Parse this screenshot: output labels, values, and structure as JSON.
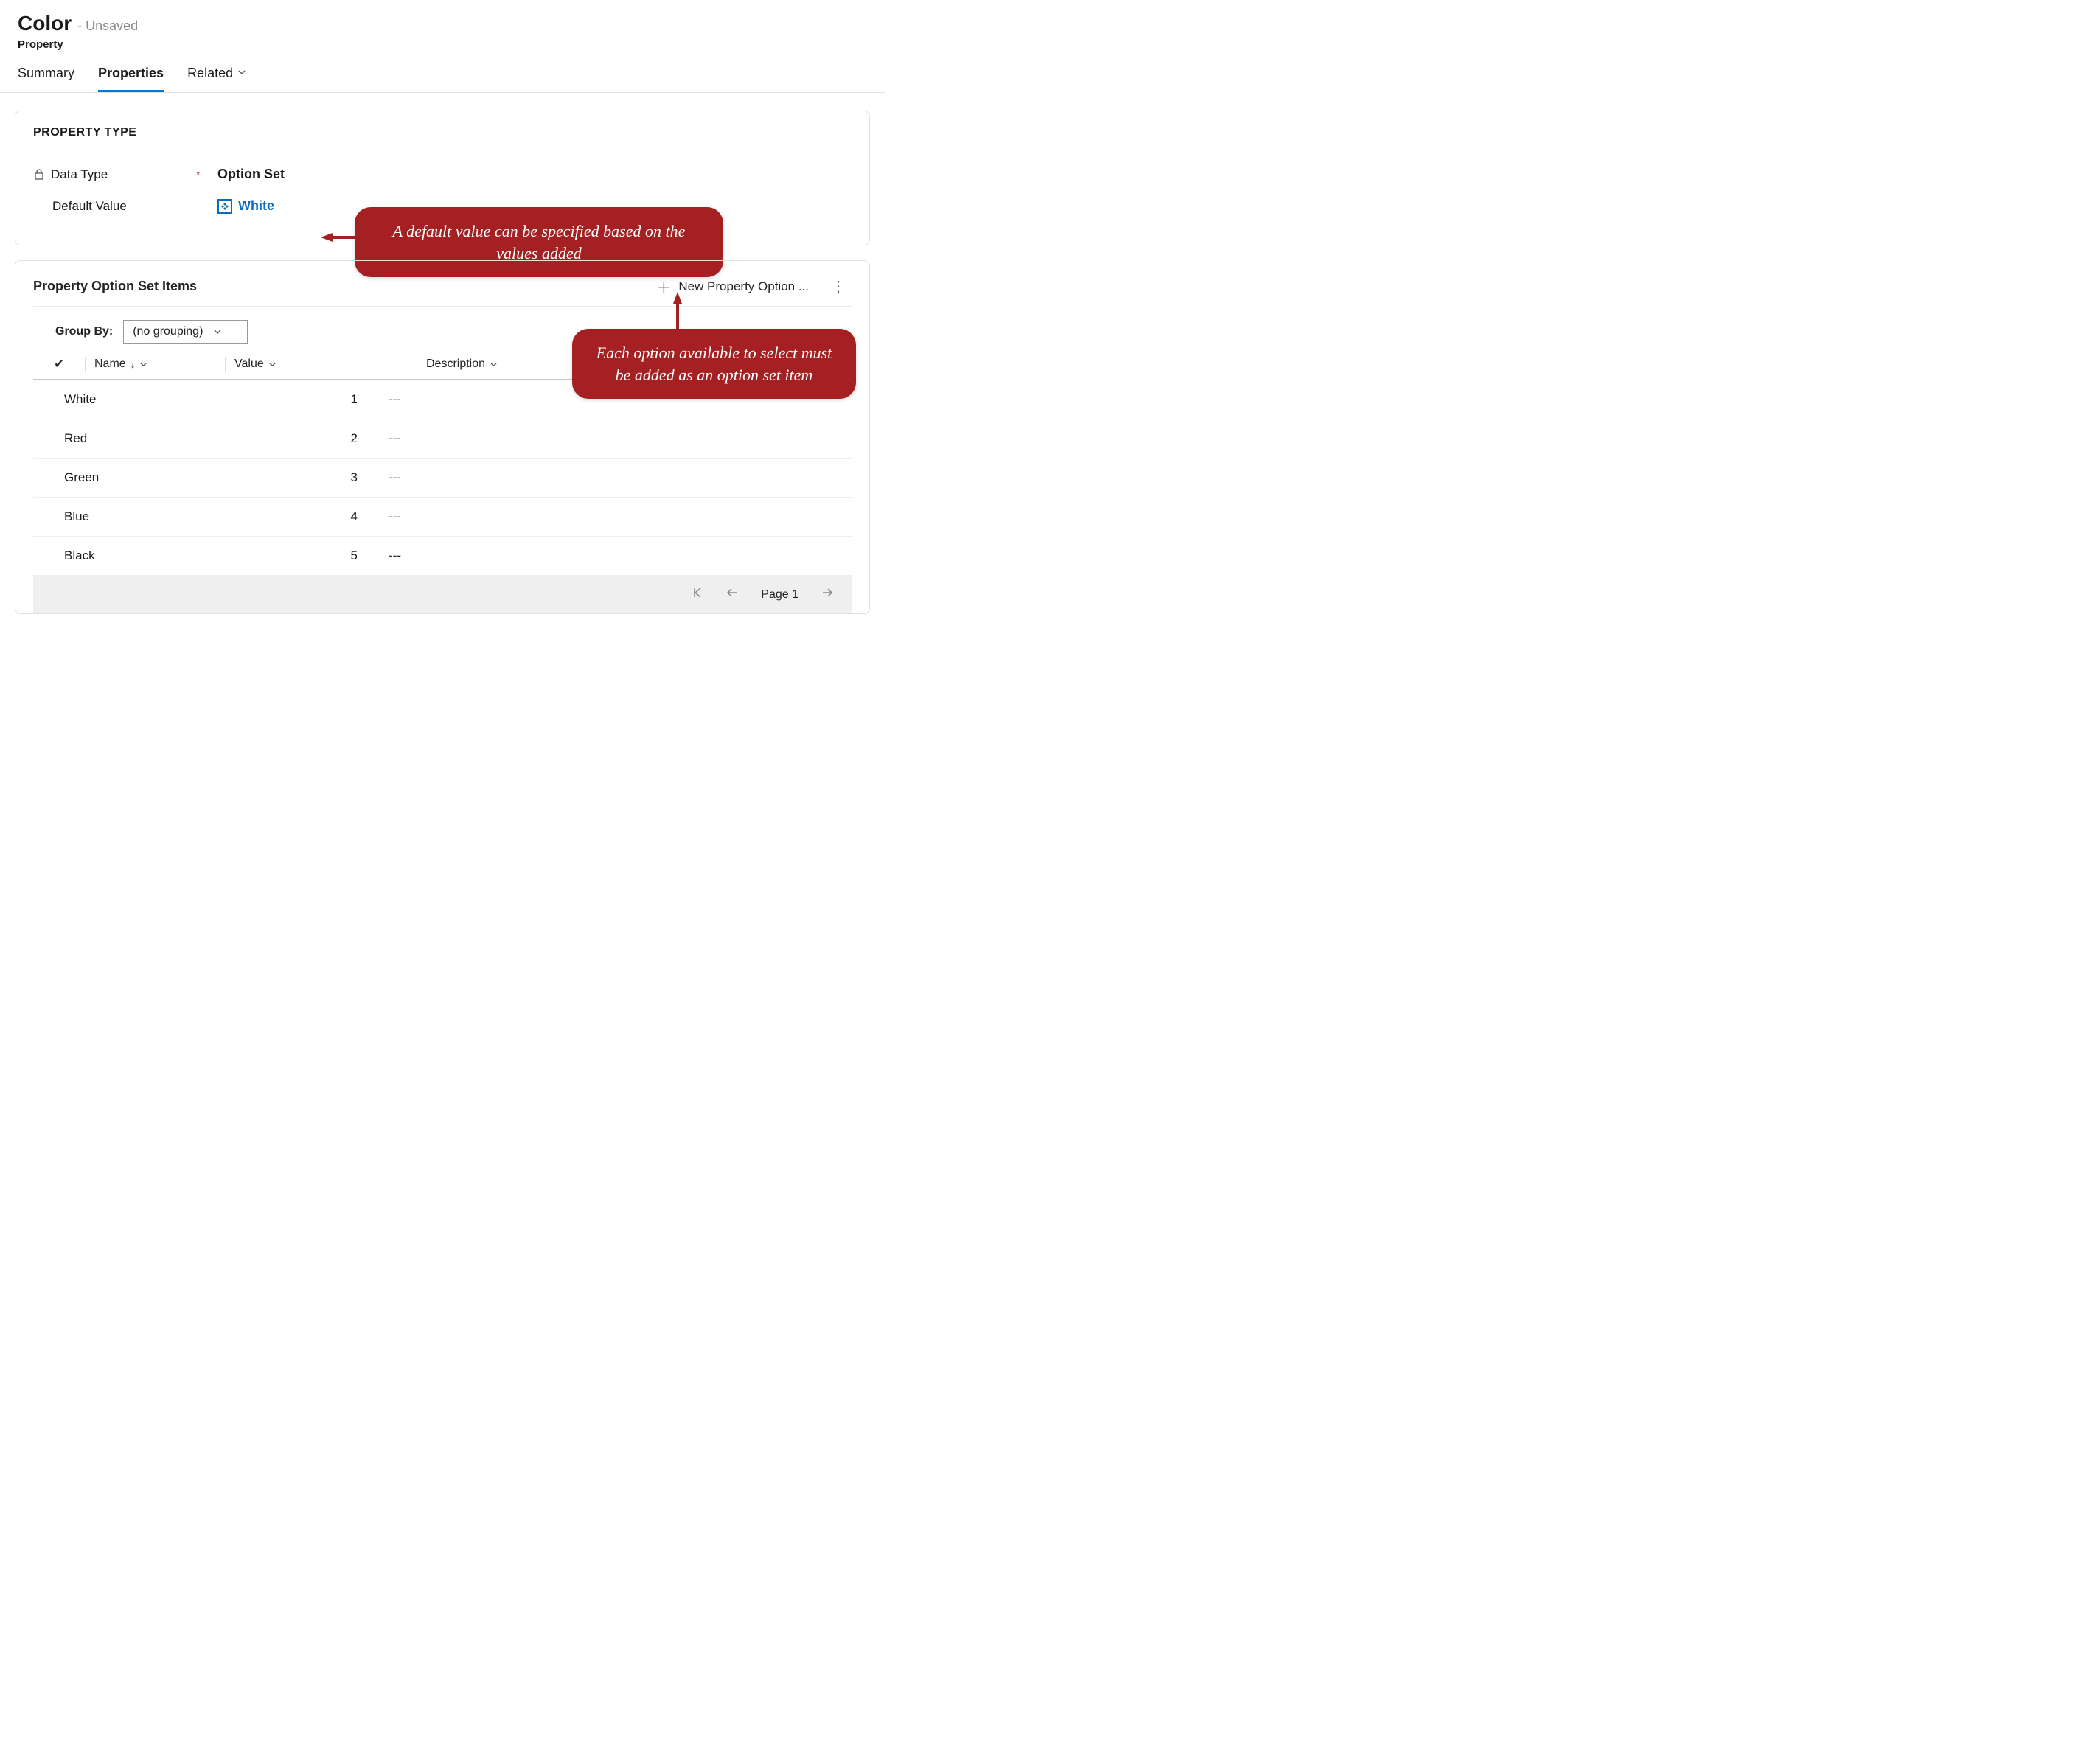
{
  "header": {
    "title": "Color",
    "status": "- Unsaved",
    "entity": "Property"
  },
  "tabs": {
    "summary": "Summary",
    "properties": "Properties",
    "related": "Related"
  },
  "property_type_section": {
    "heading": "PROPERTY TYPE",
    "data_type_label": "Data Type",
    "data_type_value": "Option Set",
    "default_value_label": "Default Value",
    "default_value": "White"
  },
  "callouts": {
    "default_value": "A default value can be specified based on the values added",
    "new_option": "Each option available to select must be added as an option set item"
  },
  "option_set_section": {
    "title": "Property Option Set Items",
    "new_button": "New Property Option ...",
    "groupby_label": "Group By:",
    "groupby_value": "(no grouping)",
    "columns": {
      "name": "Name",
      "value": "Value",
      "description": "Description"
    },
    "rows": [
      {
        "name": "White",
        "value": "1",
        "description": "---"
      },
      {
        "name": "Red",
        "value": "2",
        "description": "---"
      },
      {
        "name": "Green",
        "value": "3",
        "description": "---"
      },
      {
        "name": "Blue",
        "value": "4",
        "description": "---"
      },
      {
        "name": "Black",
        "value": "5",
        "description": "---"
      }
    ],
    "pager": {
      "page_label": "Page 1"
    }
  }
}
